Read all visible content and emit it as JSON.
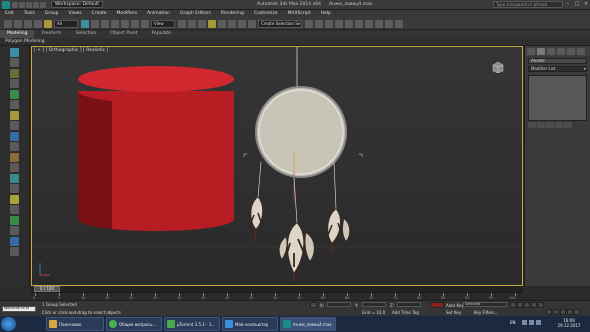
{
  "titlebar": {
    "workspace": "Workspace: Default",
    "title": "Autodesk 3ds Max 2014 x64",
    "filename": "Анжи_ловец4.max",
    "search_placeholder": "Type a keyword or phrase"
  },
  "menubar": {
    "items": [
      "Edit",
      "Tools",
      "Group",
      "Views",
      "Create",
      "Modifiers",
      "Animation",
      "Graph Editors",
      "Rendering",
      "Customize",
      "MAXScript",
      "Help"
    ]
  },
  "toolbar": {
    "selection_filter": "All",
    "coord_system": "View",
    "named_sets": "Create Selection Se"
  },
  "ribbon": {
    "tabs": [
      "Modeling",
      "Freeform",
      "Selection",
      "Object Paint",
      "Populate"
    ],
    "active_tab": "Modeling",
    "sub_label": "Polygon Modeling"
  },
  "viewport": {
    "label": "[ + ] [ Orthographic ] [ Realistic ]",
    "cylinder_color": "#b81d24"
  },
  "command_panel": {
    "object_name": "Anvets",
    "modifier_list": "Modifier List"
  },
  "timeline": {
    "frame": "0 / 100",
    "ticks": [
      "0",
      "5",
      "10",
      "15",
      "20",
      "25",
      "30",
      "35",
      "40",
      "45",
      "50",
      "55",
      "60",
      "65",
      "70",
      "75",
      "80",
      "85",
      "90",
      "95",
      "100"
    ]
  },
  "status": {
    "listener": "Welcome to M",
    "selection": "1 Group Selected",
    "prompt": "Click or click-and-drag to select objects",
    "x_label": "X:",
    "y_label": "Y:",
    "z_label": "Z:",
    "grid": "Grid = 10,0",
    "add_time_tag": "Add Time Tag",
    "auto_key": "Auto Key",
    "set_key": "Set Key",
    "key_mode": "Selected",
    "key_filters": "Key Filters..."
  },
  "taskbar": {
    "tasks": [
      {
        "label": "Поисковик",
        "color": "#d8a63a"
      },
      {
        "label": "Общие вопросы ...",
        "color": "#4caf50"
      },
      {
        "label": "µTorrent 3.5.1 - 1...",
        "color": "#4ca84c"
      },
      {
        "label": "Мой компьютер",
        "color": "#3a8fd8"
      },
      {
        "label": "Анжи_ловец4.max",
        "color": "#1a8a8a"
      }
    ],
    "lang": "EN",
    "time": "16:09",
    "date": "29.12.2017"
  }
}
